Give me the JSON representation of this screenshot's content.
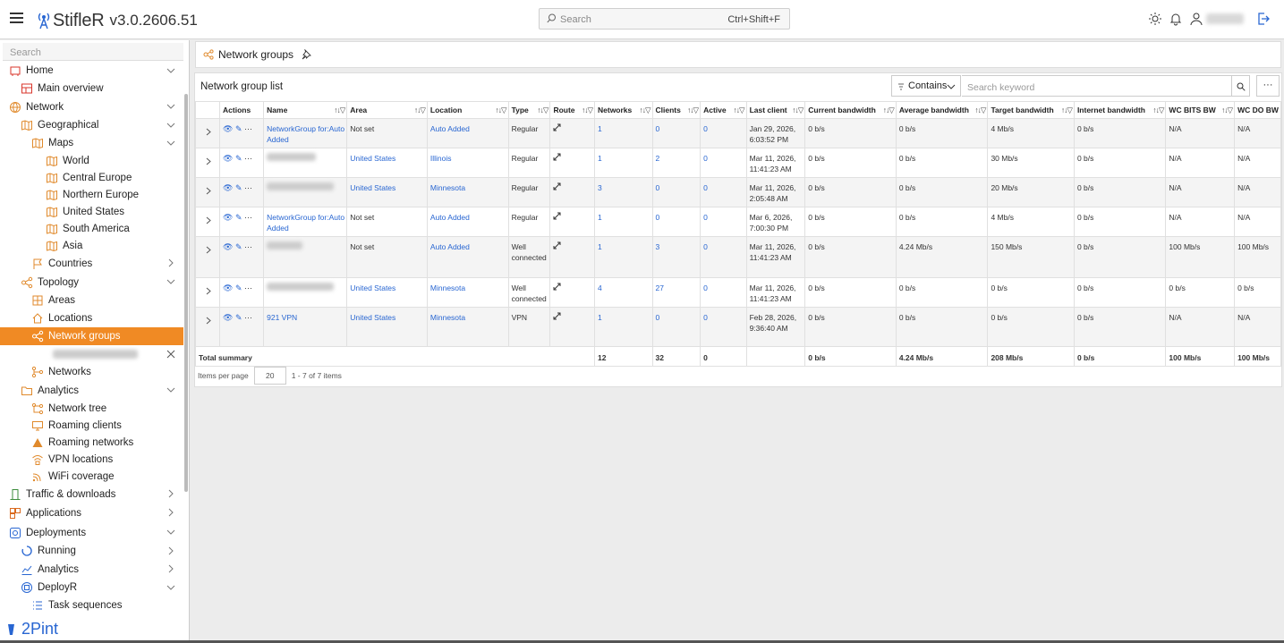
{
  "app": {
    "name": "StifleR",
    "version": "v3.0.2606.51"
  },
  "topbar": {
    "search_placeholder": "Search",
    "shortcut": "Ctrl+Shift+F"
  },
  "sidebar": {
    "search_placeholder": "Search",
    "brand": "2Pint",
    "items": [
      {
        "label": "Home",
        "level": 0,
        "icon": "home-icon",
        "color": "#d9362b",
        "chevron": "down"
      },
      {
        "label": "Main overview",
        "level": 1,
        "icon": "dashboard-icon",
        "color": "#d9362b"
      },
      {
        "label": "Network",
        "level": 0,
        "icon": "globe-icon",
        "color": "#e08a2c",
        "chevron": "down"
      },
      {
        "label": "Geographical",
        "level": 1,
        "icon": "map-icon",
        "color": "#e08a2c",
        "chevron": "down"
      },
      {
        "label": "Maps",
        "level": 2,
        "icon": "map-icon",
        "color": "#e08a2c",
        "chevron": "down"
      },
      {
        "label": "World",
        "level": 3,
        "icon": "map-icon",
        "color": "#e08a2c"
      },
      {
        "label": "Central Europe",
        "level": 3,
        "icon": "map-icon",
        "color": "#e08a2c"
      },
      {
        "label": "Northern Europe",
        "level": 3,
        "icon": "map-icon",
        "color": "#e08a2c"
      },
      {
        "label": "United States",
        "level": 3,
        "icon": "map-icon",
        "color": "#e08a2c"
      },
      {
        "label": "South America",
        "level": 3,
        "icon": "map-icon",
        "color": "#e08a2c"
      },
      {
        "label": "Asia",
        "level": 3,
        "icon": "map-icon",
        "color": "#e08a2c"
      },
      {
        "label": "Countries",
        "level": 2,
        "icon": "flag-icon",
        "color": "#e08a2c",
        "chevron": "right"
      },
      {
        "label": "Topology",
        "level": 1,
        "icon": "topology-icon",
        "color": "#e08a2c",
        "chevron": "down"
      },
      {
        "label": "Areas",
        "level": 2,
        "icon": "grid-icon",
        "color": "#e08a2c"
      },
      {
        "label": "Locations",
        "level": 2,
        "icon": "house-icon",
        "color": "#e08a2c"
      },
      {
        "label": "Network groups",
        "level": 2,
        "icon": "network-groups-icon",
        "color": "#ffffff",
        "active": true
      },
      {
        "label": "",
        "level": 3,
        "icon": "",
        "color": "#999999",
        "blurred": true,
        "close": true
      },
      {
        "label": "Networks",
        "level": 2,
        "icon": "networks-icon",
        "color": "#e08a2c"
      },
      {
        "label": "Analytics",
        "level": 1,
        "icon": "folder-icon",
        "color": "#e08a2c",
        "chevron": "down"
      },
      {
        "label": "Network tree",
        "level": 2,
        "icon": "tree-icon",
        "color": "#e08a2c"
      },
      {
        "label": "Roaming clients",
        "level": 2,
        "icon": "monitor-icon",
        "color": "#e08a2c"
      },
      {
        "label": "Roaming networks",
        "level": 2,
        "icon": "triangle-icon",
        "color": "#e08a2c"
      },
      {
        "label": "VPN locations",
        "level": 2,
        "icon": "vpn-icon",
        "color": "#e08a2c"
      },
      {
        "label": "WiFi coverage",
        "level": 2,
        "icon": "wifi-icon",
        "color": "#e08a2c"
      },
      {
        "label": "Traffic & downloads",
        "level": 0,
        "icon": "traffic-icon",
        "color": "#3c8c3c",
        "chevron": "right"
      },
      {
        "label": "Applications",
        "level": 0,
        "icon": "apps-icon",
        "color": "#d96a1f",
        "chevron": "right"
      },
      {
        "label": "Deployments",
        "level": 0,
        "icon": "deploy-icon",
        "color": "#2866d2",
        "chevron": "down"
      },
      {
        "label": "Running",
        "level": 1,
        "icon": "running-icon",
        "color": "#2866d2",
        "chevron": "right"
      },
      {
        "label": "Analytics",
        "level": 1,
        "icon": "analytics-icon",
        "color": "#2866d2",
        "chevron": "right"
      },
      {
        "label": "DeployR",
        "level": 1,
        "icon": "deployr-icon",
        "color": "#2866d2",
        "chevron": "down"
      },
      {
        "label": "Task sequences",
        "level": 2,
        "icon": "list-icon",
        "color": "#2866d2"
      }
    ]
  },
  "header": {
    "title": "Network groups"
  },
  "panel": {
    "title": "Network group list",
    "filter_mode": "Contains",
    "keyword_placeholder": "Search keyword",
    "more_label": "···"
  },
  "table": {
    "columns": [
      "",
      "Actions",
      "Name",
      "Area",
      "Location",
      "Type",
      "Route",
      "Networks",
      "Clients",
      "Active",
      "Last client",
      "Current bandwidth",
      "Average bandwidth",
      "Target bandwidth",
      "Internet bandwidth",
      "WC BITS BW",
      "WC DO BW"
    ],
    "rows": [
      {
        "name": "NetworkGroup for:Auto Added",
        "area": "Not set",
        "location": "Auto Added",
        "type": "Regular",
        "networks": "1",
        "clients": "0",
        "active": "0",
        "last_client": "Jan 29, 2026, 6:03:52 PM",
        "current_bw": "0 b/s",
        "average_bw": "0 b/s",
        "target_bw": "4 Mb/s",
        "internet_bw": "0 b/s",
        "wc_bits": "N/A",
        "wc_do": "N/A"
      },
      {
        "name": "",
        "area": "United States",
        "location": "Illinois",
        "type": "Regular",
        "networks": "1",
        "clients": "2",
        "active": "0",
        "last_client": "Mar 11, 2026, 11:41:23 AM",
        "current_bw": "0 b/s",
        "average_bw": "0 b/s",
        "target_bw": "30 Mb/s",
        "internet_bw": "0 b/s",
        "wc_bits": "N/A",
        "wc_do": "N/A"
      },
      {
        "name": "",
        "area": "United States",
        "location": "Minnesota",
        "type": "Regular",
        "networks": "3",
        "clients": "0",
        "active": "0",
        "last_client": "Mar 11, 2026, 2:05:48 AM",
        "current_bw": "0 b/s",
        "average_bw": "0 b/s",
        "target_bw": "20 Mb/s",
        "internet_bw": "0 b/s",
        "wc_bits": "N/A",
        "wc_do": "N/A"
      },
      {
        "name": "NetworkGroup for:Auto Added",
        "area": "Not set",
        "location": "Auto Added",
        "type": "Regular",
        "networks": "1",
        "clients": "0",
        "active": "0",
        "last_client": "Mar 6, 2026, 7:00:30 PM",
        "current_bw": "0 b/s",
        "average_bw": "0 b/s",
        "target_bw": "4 Mb/s",
        "internet_bw": "0 b/s",
        "wc_bits": "N/A",
        "wc_do": "N/A"
      },
      {
        "name": "",
        "area": "Not set",
        "location": "Auto Added",
        "type": "Well connected",
        "networks": "1",
        "clients": "3",
        "active": "0",
        "last_client": "Mar 11, 2026, 11:41:23 AM",
        "current_bw": "0 b/s",
        "average_bw": "4.24 Mb/s",
        "target_bw": "150 Mb/s",
        "internet_bw": "0 b/s",
        "wc_bits": "100 Mb/s",
        "wc_do": "100 Mb/s"
      },
      {
        "name": "",
        "area": "United States",
        "location": "Minnesota",
        "type": "Well connected",
        "networks": "4",
        "clients": "27",
        "active": "0",
        "last_client": "Mar 11, 2026, 11:41:23 AM",
        "current_bw": "0 b/s",
        "average_bw": "0 b/s",
        "target_bw": "0 b/s",
        "internet_bw": "0 b/s",
        "wc_bits": "0 b/s",
        "wc_do": "0 b/s"
      },
      {
        "name": "921 VPN",
        "area": "United States",
        "location": "Minnesota",
        "type": "VPN",
        "networks": "1",
        "clients": "0",
        "active": "0",
        "last_client": "Feb 28, 2026, 9:36:40 AM",
        "current_bw": "0 b/s",
        "average_bw": "0 b/s",
        "target_bw": "0 b/s",
        "internet_bw": "0 b/s",
        "wc_bits": "N/A",
        "wc_do": "N/A"
      }
    ],
    "summary": {
      "label": "Total summary",
      "networks": "12",
      "clients": "32",
      "active": "0",
      "current_bw": "0 b/s",
      "average_bw": "4.24 Mb/s",
      "target_bw": "208 Mb/s",
      "internet_bw": "0 b/s",
      "wc_bits": "100 Mb/s",
      "wc_do": "100 Mb/s"
    }
  },
  "pager": {
    "label": "Items per page",
    "per_page": "20",
    "range": "1 - 7 of 7 items"
  }
}
